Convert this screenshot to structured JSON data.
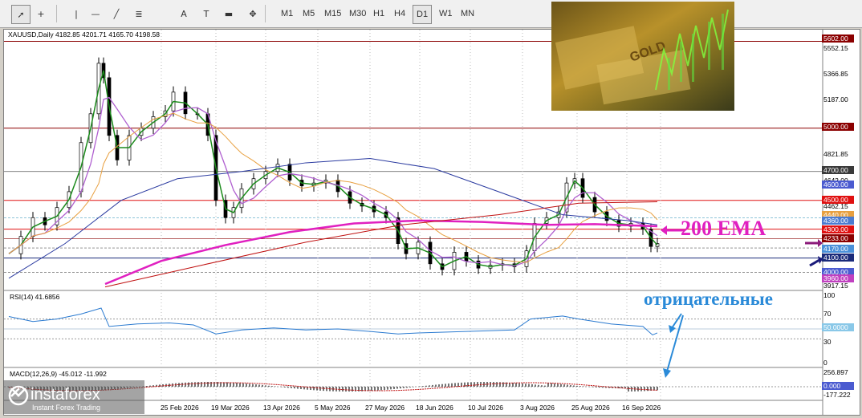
{
  "toolbar": {
    "tools": [
      "cursor-icon",
      "crosshair-icon",
      "vertical-line-icon",
      "horizontal-line-icon",
      "trendline-icon",
      "fibonacci-icon",
      "text-icon",
      "text-label-icon",
      "rectangle-icon",
      "arrows-icon"
    ],
    "timeframes": [
      "M1",
      "M5",
      "M15",
      "M30",
      "H1",
      "H4",
      "D1",
      "W1",
      "MN"
    ],
    "active_timeframe": "D1"
  },
  "header": {
    "symbol_info": "XAUUSD,Daily  4182.85 4201.71 4165.70 4198.58"
  },
  "price_axis": {
    "ticks": [
      "5552.15",
      "5366.85",
      "5187.00",
      "4821.85",
      "4642.00",
      "4462.15",
      "4282.30",
      "4102.45",
      "3917.15"
    ],
    "tags": [
      {
        "text": "5602.00",
        "color": "#8b0000"
      },
      {
        "text": "5000.00",
        "color": "#8b0000"
      },
      {
        "text": "4700.00",
        "color": "#3a3a3a"
      },
      {
        "text": "4600.00",
        "color": "#4b5bd0"
      },
      {
        "text": "4500.00",
        "color": "#e01010"
      },
      {
        "text": "4440.00",
        "color": "#e8a040"
      },
      {
        "text": "4360.00",
        "color": "#4b7bd0"
      },
      {
        "text": "4300.00",
        "color": "#e01010"
      },
      {
        "text": "4233.00",
        "color": "#8b0000"
      },
      {
        "text": "4170.00",
        "color": "#4a90d9"
      },
      {
        "text": "4100.00",
        "color": "#1a2a7a"
      },
      {
        "text": "4000.00",
        "color": "#4b5bd0"
      },
      {
        "text": "3960.00",
        "color": "#c040c0"
      }
    ]
  },
  "x_axis": {
    "labels": [
      "25 Feb 2026",
      "19 Mar 2026",
      "13 Apr 2026",
      "5 May 2026",
      "27 May 2026",
      "18 Jun 2026",
      "10 Jul 2026",
      "3 Aug 2026",
      "25 Aug 2026",
      "16 Sep 2026"
    ]
  },
  "annotations": {
    "ema_label": "200 EMA",
    "negative_label": "отрицательные"
  },
  "rsi": {
    "label": "RSI(14) 41.6856",
    "ticks": [
      "100",
      "70",
      "30",
      "0"
    ],
    "tag": "50.0000"
  },
  "macd": {
    "label": "MACD(12,26,9) -45.012 -11.992",
    "ticks": [
      "256.897",
      "-177.222"
    ],
    "tag": "0.000"
  },
  "logo": {
    "brand": "instaforex",
    "tagline": "Instant Forex Trading"
  },
  "colors": {
    "ema200": "#e020c0",
    "ma_blue": "#2a3aa0",
    "ma_orange": "#e8a040",
    "ma_red": "#c01010",
    "rsi": "#2a7ad0",
    "candle": "#000000",
    "green_ma": "#1a8a1a"
  }
}
